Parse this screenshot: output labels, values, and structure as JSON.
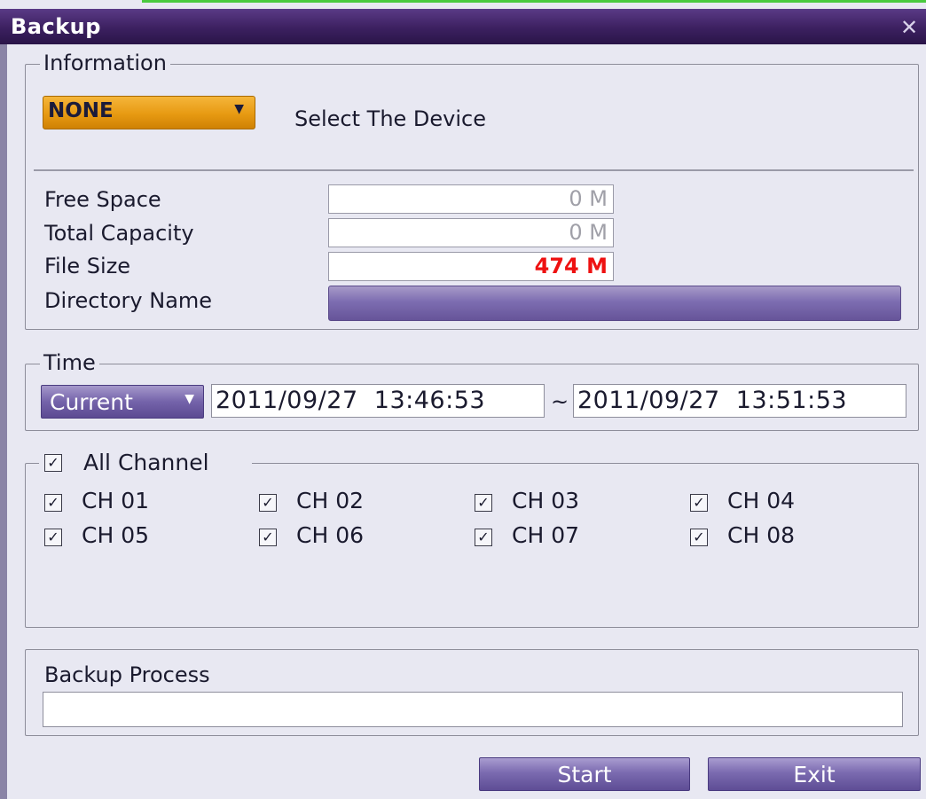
{
  "window": {
    "title": "Backup",
    "close_glyph": "✕"
  },
  "information": {
    "legend": "Information",
    "device_select_value": "NONE",
    "device_hint": "Select The Device",
    "free_space_label": "Free Space",
    "free_space_value": "0 M",
    "total_capacity_label": "Total Capacity",
    "total_capacity_value": "0 M",
    "file_size_label": "File Size",
    "file_size_value": "474 M",
    "directory_name_label": "Directory Name",
    "directory_name_value": ""
  },
  "time": {
    "legend": "Time",
    "mode_value": "Current",
    "start": "2011/09/27  13:46:53",
    "separator": "~",
    "end": "2011/09/27  13:51:53"
  },
  "channels": {
    "all_label": "All Channel",
    "all_checked": true,
    "items": [
      {
        "label": "CH 01",
        "checked": true
      },
      {
        "label": "CH 02",
        "checked": true
      },
      {
        "label": "CH 03",
        "checked": true
      },
      {
        "label": "CH 04",
        "checked": true
      },
      {
        "label": "CH 05",
        "checked": true
      },
      {
        "label": "CH 06",
        "checked": true
      },
      {
        "label": "CH 07",
        "checked": true
      },
      {
        "label": "CH 08",
        "checked": true
      }
    ]
  },
  "backup_process": {
    "label": "Backup Process",
    "progress": 0
  },
  "buttons": {
    "start": "Start",
    "exit": "Exit"
  },
  "icons": {
    "dropdown_arrow": "▼",
    "check_mark": "✓"
  },
  "colors": {
    "file_size_text": "#ee1111",
    "disabled_text": "#a0a0a8",
    "accent_purple": "#6b5aa3",
    "device_select_orange": "#e89a12"
  }
}
